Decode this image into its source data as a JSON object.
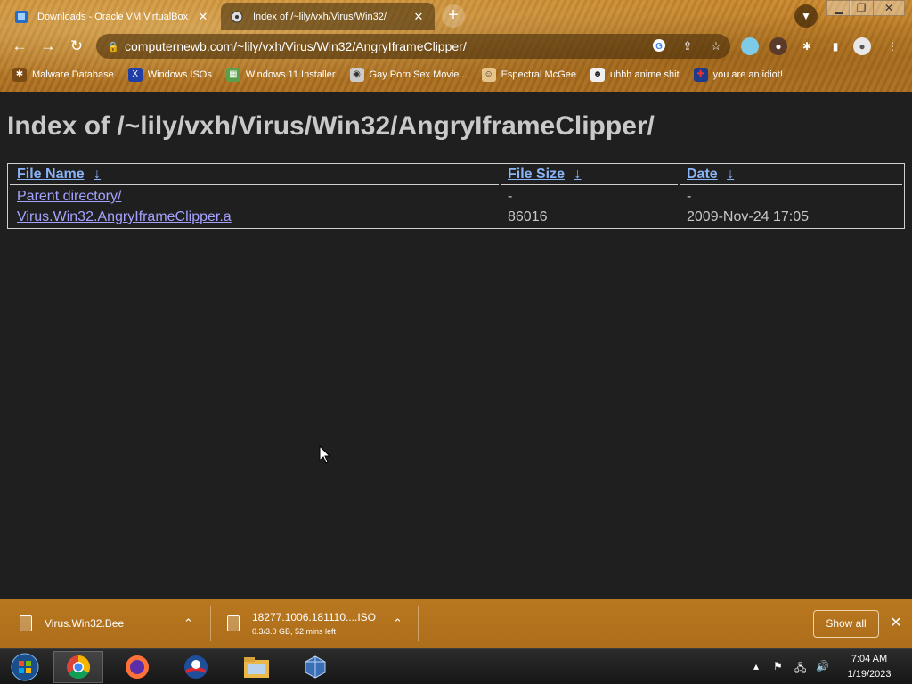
{
  "tabs": [
    {
      "title": "Downloads - Oracle VM VirtualBox",
      "active": false
    },
    {
      "title": "Index of /~lily/vxh/Virus/Win32/",
      "active": true
    }
  ],
  "address_bar": {
    "url": "computernewb.com/~lily/vxh/Virus/Win32/AngryIframeClipper/"
  },
  "bookmarks": [
    {
      "label": "Malware Database",
      "icon": "bug-icon"
    },
    {
      "label": "Windows ISOs",
      "icon": "x-icon"
    },
    {
      "label": "Windows 11 Installer",
      "icon": "image-icon"
    },
    {
      "label": "Gay Porn Sex Movie...",
      "icon": "vm-icon"
    },
    {
      "label": "Espectral McGee",
      "icon": "face-icon"
    },
    {
      "label": "uhhh anime shit",
      "icon": "anime-icon"
    },
    {
      "label": "you are an idiot!",
      "icon": "flag-icon"
    }
  ],
  "page": {
    "heading": "Index of /~lily/vxh/Virus/Win32/AngryIframeClipper/",
    "columns": [
      "File Name",
      "File Size",
      "Date"
    ],
    "sort_arrow": "↓",
    "rows": [
      {
        "name": "Parent directory/",
        "size": "-",
        "date": "-"
      },
      {
        "name": "Virus.Win32.AngryIframeClipper.a",
        "size": "86016",
        "date": "2009-Nov-24 17:05"
      }
    ]
  },
  "downloads": [
    {
      "name": "Virus.Win32.Bee",
      "status": ""
    },
    {
      "name": "18277.1006.181110....ISO",
      "status": "0.3/3.0 GB, 52 mins left"
    }
  ],
  "shelf": {
    "show_all_label": "Show all"
  },
  "taskbar": {
    "apps": [
      "start-orb",
      "chrome",
      "firefox",
      "obama-app",
      "file-explorer",
      "virtualbox"
    ],
    "time": "7:04 AM",
    "date": "1/19/2023"
  },
  "colors": {
    "chrome_bg": "#b87a26",
    "page_bg": "#1f1f1f",
    "link": "#a3a3ff",
    "header_link": "#8ab4f8",
    "heading_text": "#c9c9c9"
  }
}
